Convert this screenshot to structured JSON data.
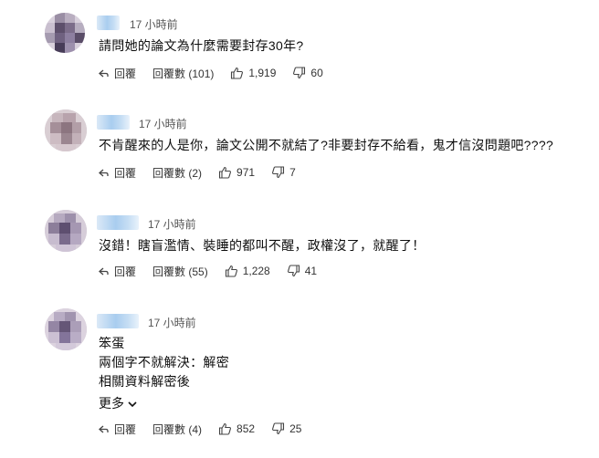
{
  "comments": [
    {
      "time": "17 小時前",
      "lines": [
        "請問她的論文為什麼需要封存30年?"
      ],
      "reply_label": "回覆",
      "replies_label": "回覆數 (101)",
      "likes": "1,919",
      "dislikes": "60"
    },
    {
      "time": "17 小時前",
      "lines": [
        "不肯醒來的人是你，論文公開不就結了?非要封存不給看，鬼才信沒問題吧????"
      ],
      "reply_label": "回覆",
      "replies_label": "回覆數 (2)",
      "likes": "971",
      "dislikes": "7"
    },
    {
      "time": "17 小時前",
      "lines": [
        "沒錯！瞎盲濫情、裝睡的都叫不醒，政權沒了，就醒了！"
      ],
      "reply_label": "回覆",
      "replies_label": "回覆數 (55)",
      "likes": "1,228",
      "dislikes": "41"
    },
    {
      "time": "17 小時前",
      "lines": [
        "笨蛋",
        "兩個字不就解決：解密",
        "相關資料解密後"
      ],
      "more_label": "更多",
      "reply_label": "回覆",
      "replies_label": "回覆數 (4)",
      "likes": "852",
      "dislikes": "25"
    }
  ],
  "icons": {
    "reply": "reply-arrow-icon",
    "replies": "speech-bubble-icon",
    "like": "thumbs-up-icon",
    "dislike": "thumbs-down-icon",
    "more": "chevron-down-icon"
  },
  "colors": {
    "text": "#0f0f0f",
    "meta": "#555555",
    "name_blur": "#a9cdef"
  }
}
